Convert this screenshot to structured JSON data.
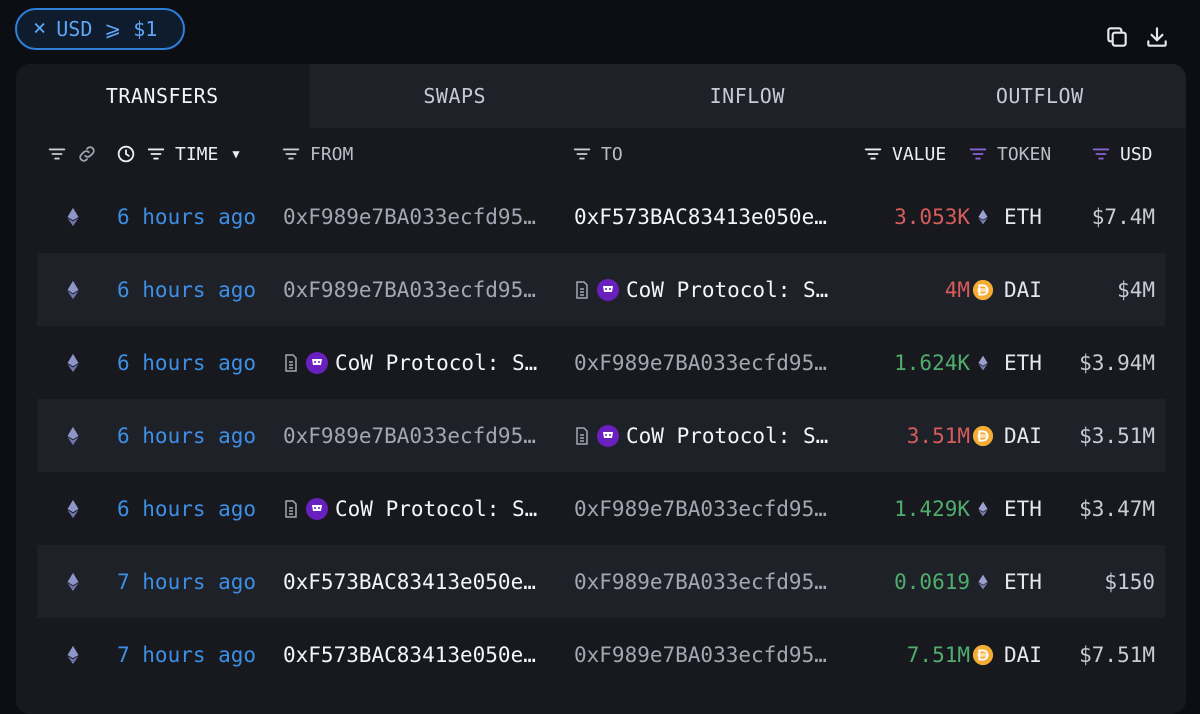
{
  "filter": {
    "label": "USD ⩾ $1"
  },
  "toolbar": {
    "copy_icon": "copy-icon",
    "download_icon": "download-icon"
  },
  "tabs": [
    {
      "label": "TRANSFERS",
      "active": true
    },
    {
      "label": "SWAPS",
      "active": false
    },
    {
      "label": "INFLOW",
      "active": false
    },
    {
      "label": "OUTFLOW",
      "active": false
    }
  ],
  "columns": {
    "time": "TIME",
    "from": "FROM",
    "to": "TO",
    "value": "VALUE",
    "token": "TOKEN",
    "usd": "USD"
  },
  "colors": {
    "accent": "#3d8fe6",
    "negative": "#d95c5c",
    "positive": "#4fae6e",
    "token_filter": "#8a63d2",
    "cow": "#6a1fbf"
  },
  "rows": [
    {
      "time": "6 hours ago",
      "from": "0xF989e7BA033ecfd95…",
      "to": "0xF573BAC83413e050e…",
      "value": "3.053K",
      "token": "ETH",
      "usd": "$7.4M"
    },
    {
      "time": "6 hours ago",
      "from": "0xF989e7BA033ecfd95…",
      "to": "CoW Protocol: S…",
      "value": "4M",
      "token": "DAI",
      "usd": "$4M"
    },
    {
      "time": "6 hours ago",
      "from": "CoW Protocol: S…",
      "to": "0xF989e7BA033ecfd95…",
      "value": "1.624K",
      "token": "ETH",
      "usd": "$3.94M"
    },
    {
      "time": "6 hours ago",
      "from": "0xF989e7BA033ecfd95…",
      "to": "CoW Protocol: S…",
      "value": "3.51M",
      "token": "DAI",
      "usd": "$3.51M"
    },
    {
      "time": "6 hours ago",
      "from": "CoW Protocol: S…",
      "to": "0xF989e7BA033ecfd95…",
      "value": "1.429K",
      "token": "ETH",
      "usd": "$3.47M"
    },
    {
      "time": "7 hours ago",
      "from": "0xF573BAC83413e050e…",
      "to": "0xF989e7BA033ecfd95…",
      "value": "0.0619",
      "token": "ETH",
      "usd": "$150"
    },
    {
      "time": "7 hours ago",
      "from": "0xF573BAC83413e050e…",
      "to": "0xF989e7BA033ecfd95…",
      "value": "7.51M",
      "token": "DAI",
      "usd": "$7.51M"
    }
  ]
}
